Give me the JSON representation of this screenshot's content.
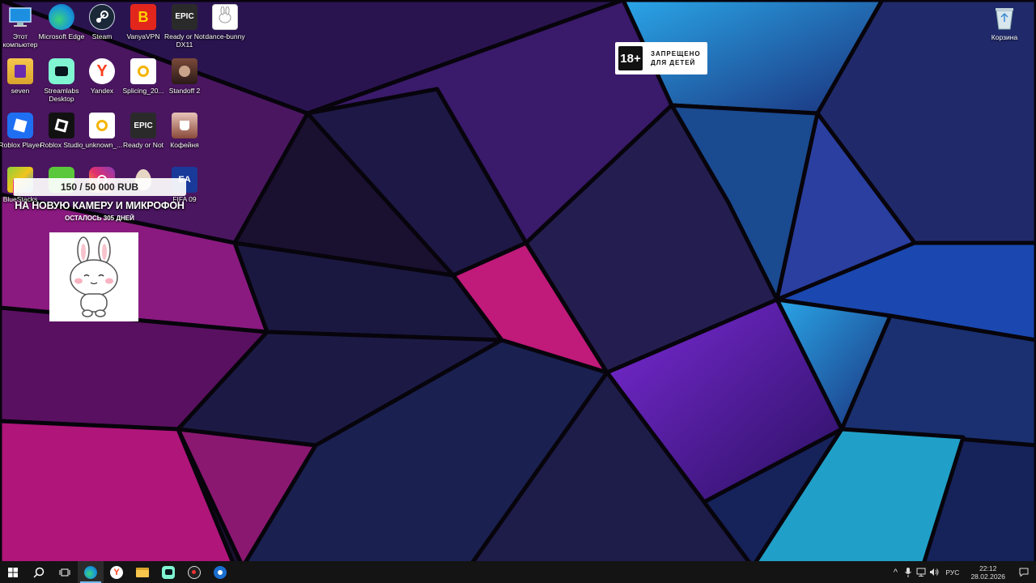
{
  "desktop": {
    "icons": [
      {
        "label": "Этот компьютер",
        "icon": "computer-icon"
      },
      {
        "label": "Microsoft Edge",
        "icon": "edge-icon"
      },
      {
        "label": "Steam",
        "icon": "steam-icon"
      },
      {
        "label": "VanyaVPN",
        "icon": "vanyavpn-icon"
      },
      {
        "label": "Ready or Not DX11",
        "icon": "epic-games-icon"
      },
      {
        "label": "dance-bunny",
        "icon": "image-file-icon"
      },
      {
        "label": "seven",
        "icon": "folder-file-icon"
      },
      {
        "label": "Streamlabs Desktop",
        "icon": "streamlabs-icon"
      },
      {
        "label": "Yandex",
        "icon": "yandex-icon"
      },
      {
        "label": "Splicing_20...",
        "icon": "video-file-icon"
      },
      {
        "label": "Standoff 2",
        "icon": "standoff-icon"
      },
      {
        "label": "Roblox Player",
        "icon": "roblox-player-icon"
      },
      {
        "label": "Roblox Studio",
        "icon": "roblox-studio-icon"
      },
      {
        "label": "_unknown_...",
        "icon": "video-file-icon"
      },
      {
        "label": "Ready or Not",
        "icon": "epic-games-icon"
      },
      {
        "label": "Кофейня",
        "icon": "coffee-shop-icon"
      },
      {
        "label": "BlueStacks",
        "icon": "bluestacks-icon"
      },
      {
        "label": "",
        "icon": "green-app-icon"
      },
      {
        "label": "",
        "icon": "instagram-icon"
      },
      {
        "label": "",
        "icon": "egg-icon"
      },
      {
        "label": "FIFA 09",
        "icon": "ea-icon"
      }
    ],
    "recycle_bin": {
      "label": "Корзина",
      "icon": "recycle-bin-icon"
    }
  },
  "donation_widget": {
    "progress_text": "150 / 50 000 RUB",
    "progress_fraction": 0.003,
    "title": "НА НОВУЮ КАМЕРУ И МИКРОФОН",
    "days_left": "ОСТАЛОСЬ 305 ДНЕЙ"
  },
  "age_badge": {
    "rating": "18+",
    "line1": "ЗАПРЕЩЕНО",
    "line2": "ДЛЯ ДЕТЕЙ"
  },
  "taskbar": {
    "pinned": [
      {
        "icon": "start-icon"
      },
      {
        "icon": "search-icon"
      },
      {
        "icon": "task-view-icon"
      },
      {
        "icon": "edge-icon",
        "active": true
      },
      {
        "icon": "yandex-icon"
      },
      {
        "icon": "file-explorer-icon"
      },
      {
        "icon": "streamlabs-icon"
      },
      {
        "icon": "obs-icon"
      },
      {
        "icon": "steam-icon"
      }
    ],
    "tray": {
      "language": "РУС",
      "time": "22:12",
      "date": "28.02.2026"
    }
  },
  "colors": {
    "taskbar_bg": "#141414",
    "accent": "#76b9ed",
    "donation_fill": "#e9356f"
  }
}
